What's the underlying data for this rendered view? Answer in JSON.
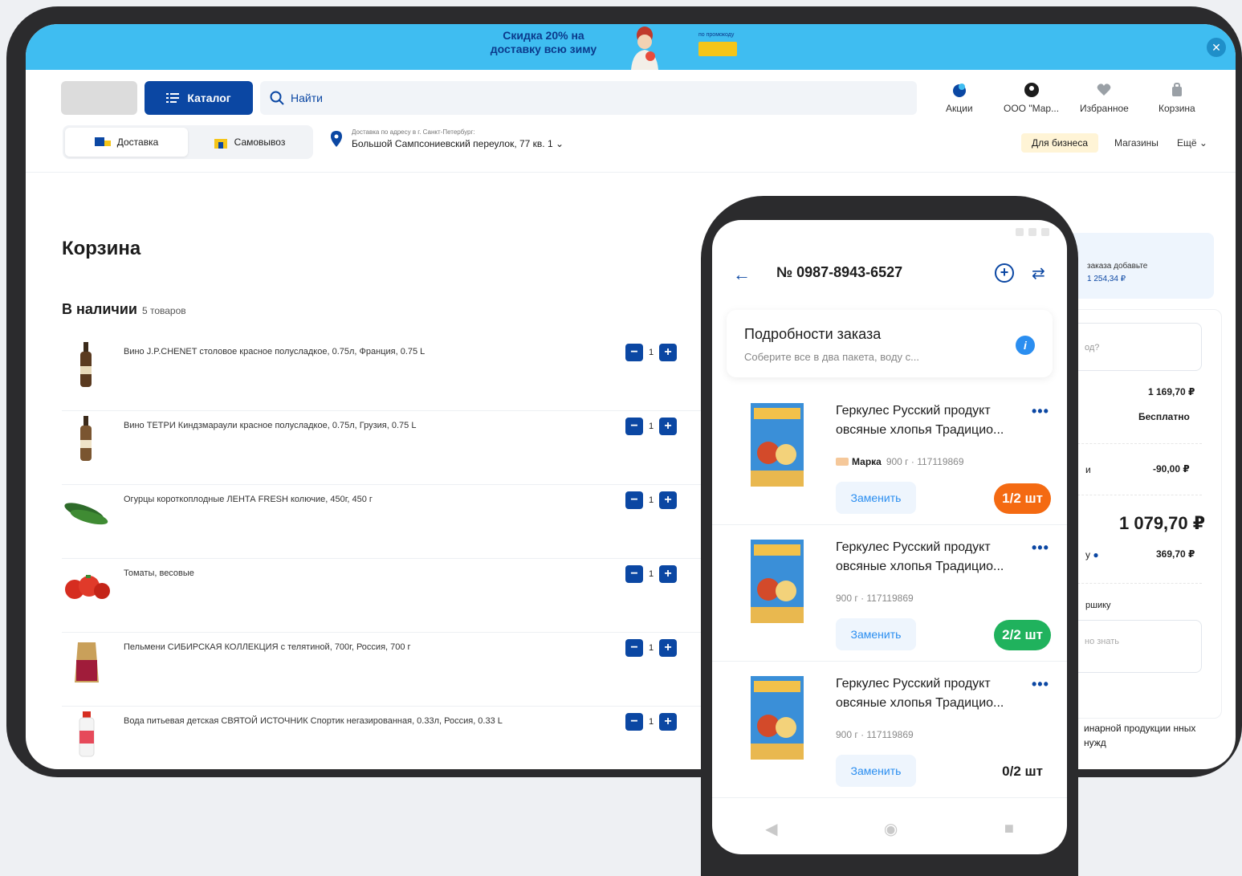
{
  "banner": {
    "title": "Скидка 20% на доставку всю зиму",
    "promo_label": "по промокоду"
  },
  "header": {
    "catalog_label": "Каталог",
    "search_placeholder": "Найти",
    "icons": [
      {
        "name": "promo-icon",
        "label": "Акции"
      },
      {
        "name": "account-icon",
        "label": "ООО \"Мар..."
      },
      {
        "name": "heart-icon",
        "label": "Избранное"
      },
      {
        "name": "cart-icon",
        "label": "Корзина"
      }
    ],
    "tabs": [
      "Доставка",
      "Самовывоз"
    ],
    "address_label": "Доставка по адресу в г. Санкт-Петербург:",
    "address_value": "Большой Сампсониевский переулок, 77 кв. 1",
    "business_label": "Для бизнеса",
    "links": [
      "Магазины",
      "Ещё"
    ]
  },
  "cart": {
    "title": "Корзина",
    "available_label": "В наличии",
    "available_count": "5 товаров",
    "items": [
      {
        "name": "Вино J.P.CHENET столовое красное полусладкое, 0.75л, Франция, 0.75 L",
        "qty": "1"
      },
      {
        "name": "Вино ТЕТРИ Киндзмараули красное полусладкое, 0.75л, Грузия, 0.75 L",
        "qty": "1"
      },
      {
        "name": "Огурцы короткоплодные ЛЕНТА FRESH колючие, 450г, 450 г",
        "qty": "1"
      },
      {
        "name": "Томаты, весовые",
        "qty": "1"
      },
      {
        "name": "Пельмени СИБИРСКАЯ КОЛЛЕКЦИЯ с телятиной, 700г, Россия, 700 г",
        "qty": "1"
      },
      {
        "name": "Вода питьевая детская СВЯТОЙ ИСТОЧНИК Спортик негазированная, 0.33л, Россия, 0.33 L",
        "qty": "1"
      }
    ]
  },
  "summary": {
    "notice": "заказа добавьте",
    "notice_amount": "1 254,34 ₽",
    "input_hint": "од?",
    "subtotal": "1 169,70 ₽",
    "delivery": "Бесплатно",
    "discount_label": "и",
    "discount": "-90,00 ₽",
    "total": "1 079,70 ₽",
    "bonus_label": "у",
    "bonus": "369,70 ₽",
    "bag_label": "ршику",
    "comment_placeholder": "но знать",
    "footnote": "инарной продукции нных нужд"
  },
  "phone": {
    "order_number": "№ 0987-8943-6527",
    "details_title": "Подробности заказа",
    "details_subtitle": "Соберите все в два пакета, воду с...",
    "items": [
      {
        "name": "Геркулес Русский продукт овсяные хлопья Традицио...",
        "brand": "Марка",
        "meta": "900 г · 117119869",
        "replace": "Заменить",
        "count": "1/2 шт"
      },
      {
        "name": "Геркулес Русский продукт овсяные хлопья Традицио...",
        "brand": "",
        "meta": "900 г · 117119869",
        "replace": "Заменить",
        "count": "2/2 шт"
      },
      {
        "name": "Геркулес Русский продукт овсяные хлопья Традицио...",
        "brand": "",
        "meta": "900 г · 117119869",
        "replace": "Заменить",
        "count": "0/2 шт"
      }
    ]
  },
  "colors": {
    "brand_blue": "#0b47a3",
    "banner_blue": "#3fbdf1",
    "orange": "#f46a12",
    "green": "#20b25d"
  }
}
